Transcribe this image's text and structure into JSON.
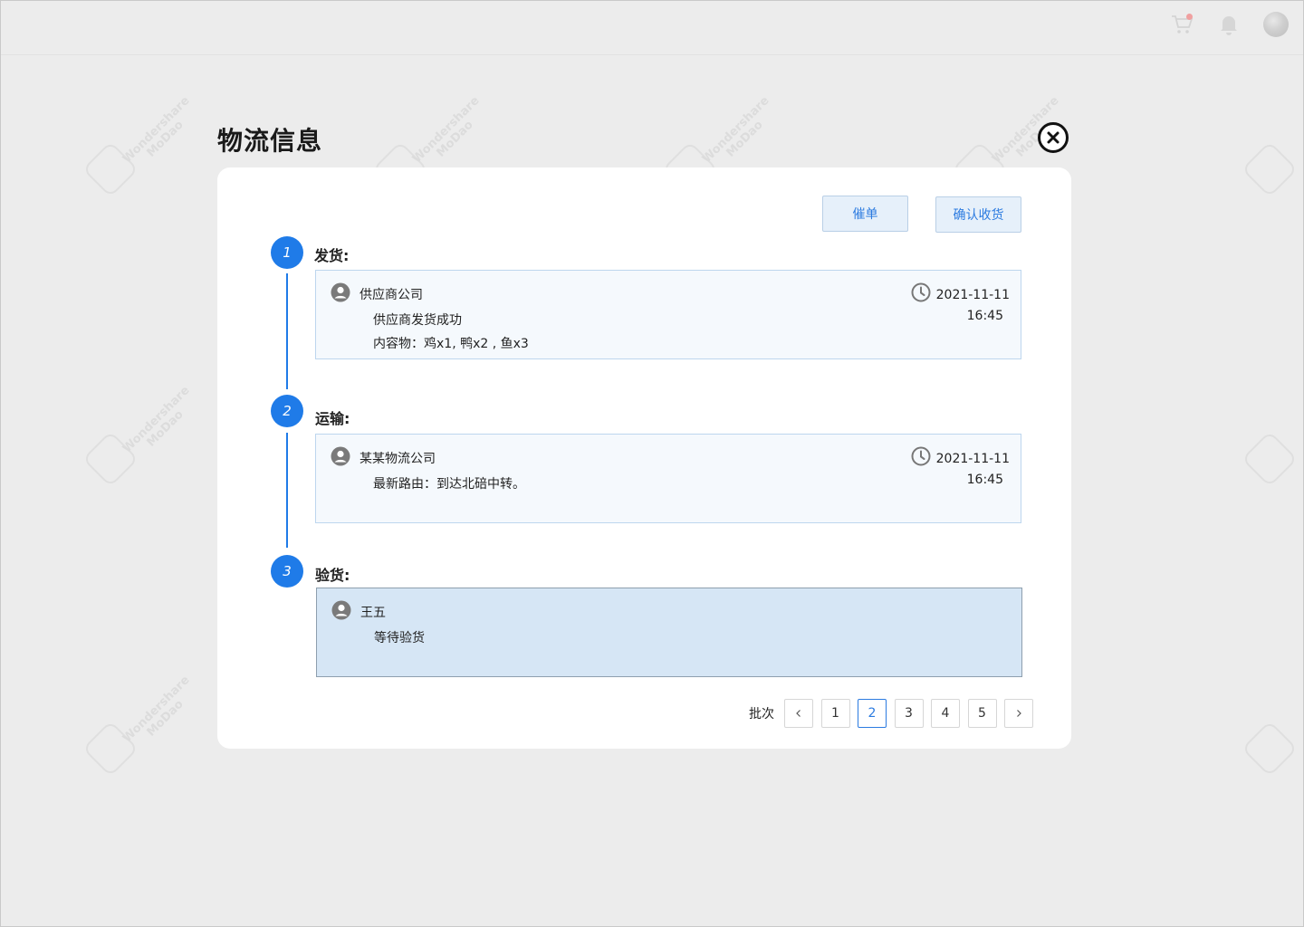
{
  "page": {
    "title": "物流信息"
  },
  "actions": {
    "urge_label": "催单",
    "confirm_label": "确认收货"
  },
  "steps": [
    {
      "number": "1",
      "label": "发货:",
      "person": "供应商公司",
      "lines": [
        "供应商发货成功",
        "内容物：鸡x1, 鸭x2 , 鱼x3"
      ],
      "date": "2021-11-11",
      "time": "16:45"
    },
    {
      "number": "2",
      "label": "运输:",
      "person": "某某物流公司",
      "lines": [
        "最新路由：到达北碚中转。"
      ],
      "date": "2021-11-11",
      "time": "16:45"
    },
    {
      "number": "3",
      "label": "验货:",
      "person": "王五",
      "lines": [
        "等待验货"
      ]
    }
  ],
  "pager": {
    "label": "批次",
    "pages": [
      "1",
      "2",
      "3",
      "4",
      "5"
    ],
    "current": "2"
  },
  "watermark": {
    "brand": "Wondershare",
    "product": "MoDao"
  },
  "icons": {
    "cart": "cart-icon",
    "bell": "bell-icon",
    "close": "close-circle-icon",
    "user": "user-circle-icon",
    "clock": "clock-icon"
  },
  "colors": {
    "accent": "#1f7be8",
    "active_box": "#d6e6f5",
    "box": "#f5f9fd"
  }
}
